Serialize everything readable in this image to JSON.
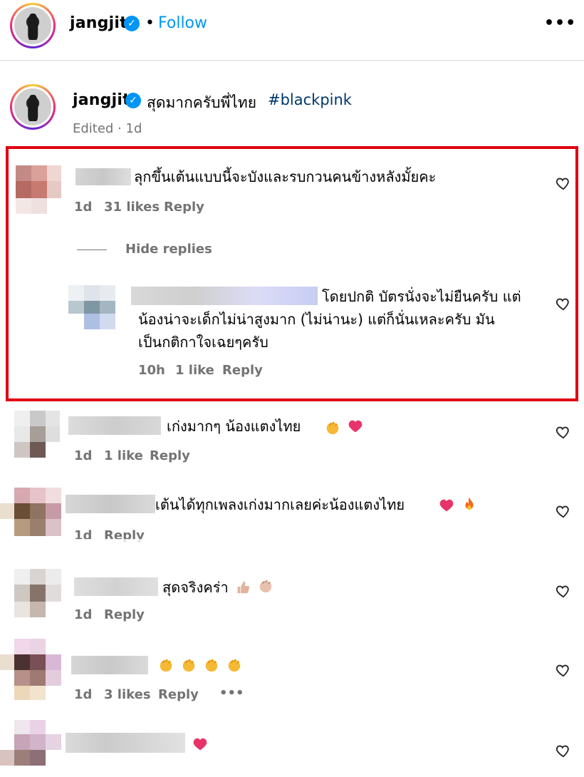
{
  "header": {
    "username": "jangjit",
    "separator": "•",
    "follow_label": "Follow",
    "more_label": "•••"
  },
  "caption": {
    "username": "jangjit",
    "text": "สุดมากครับพี่ไทย",
    "hashtag": "#blackpink",
    "meta": "Edited · 1d"
  },
  "comments": [
    {
      "text": "ลุกขึ้นเต้นแบบนี้จะบังและรบกวนคนข้างหลังมั้ยคะ",
      "time": "1d",
      "likes": "31 likes",
      "reply": "Reply",
      "hide_replies": "Hide replies",
      "reply_item": {
        "lines": [
          "โดยปกติ บัตรนั่งจะไม่ยืนครับ แต่",
          "น้องน่าจะเด็กไม่น่าสูงมาก (ไม่น่านะ) แต่ก็นั่นเหละครับ มัน",
          "เป็นกติกาใจเฉยๆครับ"
        ],
        "time": "10h",
        "likes": "1 like",
        "reply": "Reply"
      }
    },
    {
      "text": "เก่งมากๆ น้องแตงไทย",
      "time": "1d",
      "likes": "1 like",
      "reply": "Reply"
    },
    {
      "text": "เต้นได้ทุกเพลงเก่งมากเลยค่ะน้องแตงไทย",
      "time": "1d",
      "reply": "Reply"
    },
    {
      "text": "สุดจริงคร่า",
      "time": "1d",
      "reply": "Reply"
    },
    {
      "text": "",
      "time": "1d",
      "likes": "3 likes",
      "reply": "Reply",
      "more": "•••"
    },
    {
      "text": ""
    }
  ],
  "colors": {
    "accent": "#0095f6",
    "highlight_box": "#e00012",
    "muted": "#737373"
  }
}
